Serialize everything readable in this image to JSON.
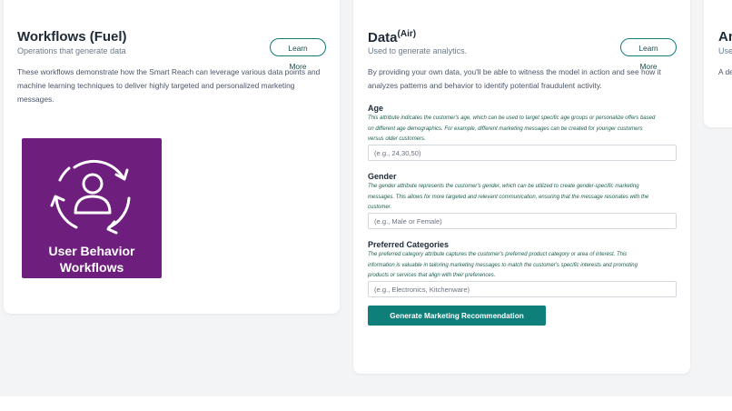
{
  "fuel_card": {
    "title": "Workflows (Fuel)",
    "subtitle": "Operations that generate data",
    "learn_more": "Learn More",
    "description_lines": [
      "These workflows demonstrate how the Smart Reach can leverage various data points and",
      "machine learning techniques to deliver highly targeted and personalized marketing",
      "messages."
    ],
    "tile": {
      "icon": "user-cycle-icon",
      "line1": "User Behavior",
      "line2": "Workflows",
      "color": "#6e1f7d"
    }
  },
  "air_card": {
    "title": "Data",
    "title_sup": "(Air)",
    "subtitle": "Used to generate analytics.",
    "learn_more": "Learn More",
    "description_lines": [
      "By providing your own data, you'll be able to witness the model in action and see how it",
      "analyzes patterns and behavior to identify potential fraudulent activity."
    ],
    "fields": [
      {
        "label": "Age",
        "help_lines": [
          "This attribute indicates the customer's age, which can be used to target specific age groups or personalize offers based",
          "on different age demographics. For example, different marketing messages can be created for younger customers",
          "versus older customers."
        ],
        "placeholder": "(e.g., 24,30,50)"
      },
      {
        "label": "Gender",
        "help_lines": [
          "The gender attribute represents the customer's gender, which can be utilized to create gender-specific marketing",
          "messages. This allows for more targeted and relevant communication, ensuring that the message resonates with the",
          "customer."
        ],
        "placeholder": "(e.g., Male or Female)"
      },
      {
        "label": "Preferred Categories",
        "help_lines": [
          "The preferred category attribute captures the customer's preferred product category or area of interest. This",
          "information is valuable in tailoring marketing messages to match the customer's specific interests and promoting",
          "products or services that align with their preferences."
        ],
        "placeholder": "(e.g., Electronics, Kitchenware)"
      }
    ],
    "generate_button": "Generate Marketing Recommendation",
    "accent": "#0f7f7a"
  },
  "analytics_card": {
    "title": "An",
    "subtitle": "Used",
    "description": "A de"
  }
}
